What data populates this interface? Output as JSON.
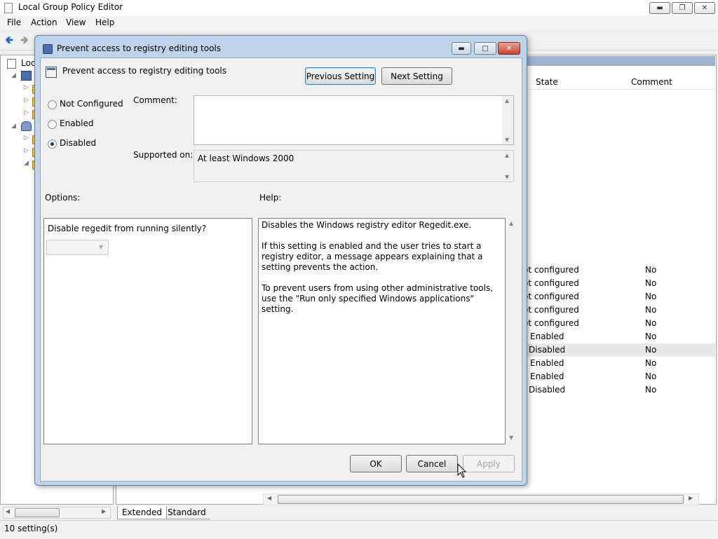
{
  "main_window": {
    "title": "Local Group Policy Editor",
    "menu": [
      "File",
      "Action",
      "View",
      "Help"
    ],
    "tree_root_label": "Loc",
    "list_columns": [
      "State",
      "Comment"
    ],
    "list_rows": [
      {
        "state": "ot configured",
        "comment": "No"
      },
      {
        "state": "ot configured",
        "comment": "No"
      },
      {
        "state": "ot configured",
        "comment": "No"
      },
      {
        "state": "ot configured",
        "comment": "No"
      },
      {
        "state": "ot configured",
        "comment": "No"
      },
      {
        "state": "Enabled",
        "comment": "No"
      },
      {
        "state": "Disabled",
        "comment": "No",
        "selected": true
      },
      {
        "state": "Enabled",
        "comment": "No"
      },
      {
        "state": "Enabled",
        "comment": "No"
      },
      {
        "state": "Disabled",
        "comment": "No"
      }
    ],
    "tabs": [
      "Extended",
      "Standard"
    ],
    "status": "10 setting(s)"
  },
  "dialog": {
    "title": "Prevent access to registry editing tools",
    "setting_name": "Prevent access to registry editing tools",
    "previous_button": "Previous Setting",
    "next_button": "Next Setting",
    "radio_options": [
      {
        "label": "Not Configured",
        "checked": false
      },
      {
        "label": "Enabled",
        "checked": false
      },
      {
        "label": "Disabled",
        "checked": true
      }
    ],
    "comment_label": "Comment:",
    "comment_value": "",
    "supported_on_label": "Supported on:",
    "supported_on_value": "At least Windows 2000",
    "options_label": "Options:",
    "help_label": "Help:",
    "option_question": "Disable regedit from running silently?",
    "option_select_value": "",
    "help_paragraphs": [
      "Disables the Windows registry editor Regedit.exe.",
      "If this setting is enabled and the user tries to start a registry editor, a message appears explaining that a setting prevents the action.",
      "To prevent users from using other administrative tools, use the \"Run only specified Windows applications\" setting."
    ],
    "ok_button": "OK",
    "cancel_button": "Cancel",
    "apply_button": "Apply"
  }
}
